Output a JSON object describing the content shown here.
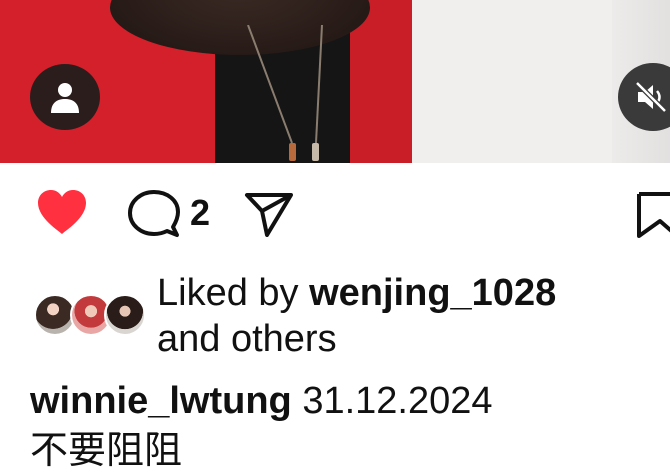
{
  "post": {
    "comment_count": "2",
    "liked_prefix": "Liked by ",
    "liked_user": "wenjing_1028",
    "liked_suffix": "and others",
    "caption_user": "winnie_lwtung",
    "caption_text": "31.12.2024",
    "caption_line2": "不要阻阻"
  },
  "icons": {
    "tag_people": "person-icon",
    "mute": "speaker-muted-icon",
    "like": "heart-filled-icon",
    "comment": "comment-bubble-icon",
    "share": "paper-plane-icon",
    "save": "bookmark-icon"
  },
  "colors": {
    "like_red": "#ff3040",
    "overlay_dark": "#2b1d1c"
  }
}
